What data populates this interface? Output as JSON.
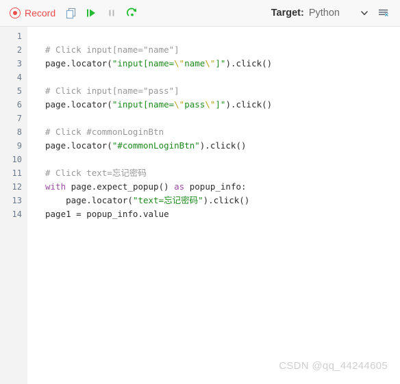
{
  "toolbar": {
    "record_label": "Record",
    "icons": [
      {
        "name": "record-icon",
        "label": "Record"
      },
      {
        "name": "copy-icon",
        "label": "Copy"
      },
      {
        "name": "step-over-icon",
        "label": "Step over"
      },
      {
        "name": "pause-icon",
        "label": "Pause"
      },
      {
        "name": "resume-icon",
        "label": "Resume"
      }
    ],
    "target_label": "Target:",
    "target_value": "Python",
    "chevron_icon": "chevron-down-icon",
    "clear_icon": "clear-log-icon"
  },
  "colors": {
    "record_red": "#ef4b4b",
    "play_green": "#22bb33",
    "pause_gray": "#b0b0b0",
    "header_bg": "#f8f8f8",
    "gutter_bg": "#f3f3f3",
    "line_number": "#6a7a8c",
    "comment": "#969896",
    "string": "#1d8a1d",
    "escape": "#b8a317",
    "keyword": "#9a4fa3",
    "code_text": "#2b2b2b",
    "watermark": "#cfcfcf"
  },
  "editor": {
    "language": "Python",
    "line_numbers": [
      1,
      2,
      3,
      4,
      5,
      6,
      7,
      8,
      9,
      10,
      11,
      12,
      13,
      14
    ],
    "lines": [
      {
        "n": 1,
        "tokens": []
      },
      {
        "n": 2,
        "tokens": [
          {
            "t": "com",
            "s": "# Click input[name=\"name\"]"
          }
        ]
      },
      {
        "n": 3,
        "tokens": [
          {
            "t": "txt",
            "s": "page.locator("
          },
          {
            "t": "str",
            "s": "\"input[name="
          },
          {
            "t": "esc",
            "s": "\\\""
          },
          {
            "t": "str",
            "s": "name"
          },
          {
            "t": "esc",
            "s": "\\\""
          },
          {
            "t": "str",
            "s": "]\""
          },
          {
            "t": "txt",
            "s": ").click()"
          }
        ]
      },
      {
        "n": 4,
        "tokens": []
      },
      {
        "n": 5,
        "tokens": [
          {
            "t": "com",
            "s": "# Click input[name=\"pass\"]"
          }
        ]
      },
      {
        "n": 6,
        "tokens": [
          {
            "t": "txt",
            "s": "page.locator("
          },
          {
            "t": "str",
            "s": "\"input[name="
          },
          {
            "t": "esc",
            "s": "\\\""
          },
          {
            "t": "str",
            "s": "pass"
          },
          {
            "t": "esc",
            "s": "\\\""
          },
          {
            "t": "str",
            "s": "]\""
          },
          {
            "t": "txt",
            "s": ").click()"
          }
        ]
      },
      {
        "n": 7,
        "tokens": []
      },
      {
        "n": 8,
        "tokens": [
          {
            "t": "com",
            "s": "# Click #commonLoginBtn"
          }
        ]
      },
      {
        "n": 9,
        "tokens": [
          {
            "t": "txt",
            "s": "page.locator("
          },
          {
            "t": "str",
            "s": "\"#commonLoginBtn\""
          },
          {
            "t": "txt",
            "s": ").click()"
          }
        ]
      },
      {
        "n": 10,
        "tokens": []
      },
      {
        "n": 11,
        "tokens": [
          {
            "t": "com",
            "s": "# Click text=忘记密码"
          }
        ]
      },
      {
        "n": 12,
        "tokens": [
          {
            "t": "kw",
            "s": "with"
          },
          {
            "t": "txt",
            "s": " page.expect_popup() "
          },
          {
            "t": "kw",
            "s": "as"
          },
          {
            "t": "txt",
            "s": " popup_info:"
          }
        ]
      },
      {
        "n": 13,
        "tokens": [
          {
            "t": "txt",
            "s": "    page.locator("
          },
          {
            "t": "str",
            "s": "\"text=忘记密码\""
          },
          {
            "t": "txt",
            "s": ").click()"
          }
        ]
      },
      {
        "n": 14,
        "tokens": [
          {
            "t": "txt",
            "s": "page1 = popup_info.value"
          }
        ]
      }
    ]
  },
  "watermark": {
    "text": "CSDN @qq_44244605"
  }
}
